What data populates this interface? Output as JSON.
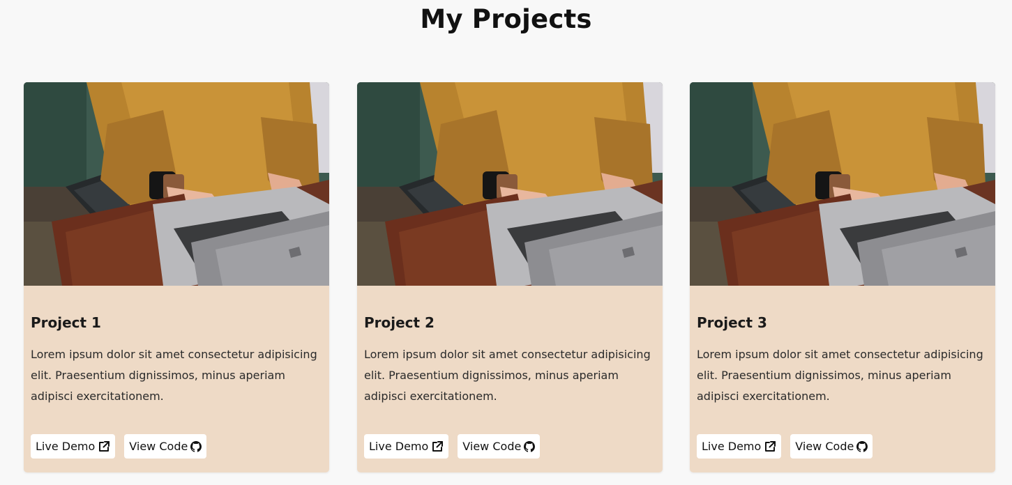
{
  "page": {
    "title": "My Projects"
  },
  "projects": [
    {
      "title": "Project 1",
      "description": "Lorem ipsum dolor sit amet consectetur adipisicing elit. Praesentium dignissimos, minus aperiam adipisci exercitationem.",
      "live_demo_label": "Live Demo",
      "view_code_label": "View Code",
      "image_icon": "laptop-photo",
      "live_demo_icon": "external-link-icon",
      "view_code_icon": "github-icon"
    },
    {
      "title": "Project 2",
      "description": "Lorem ipsum dolor sit amet consectetur adipisicing elit. Praesentium dignissimos, minus aperiam adipisci exercitationem.",
      "live_demo_label": "Live Demo",
      "view_code_label": "View Code",
      "image_icon": "laptop-photo",
      "live_demo_icon": "external-link-icon",
      "view_code_icon": "github-icon"
    },
    {
      "title": "Project 3",
      "description": "Lorem ipsum dolor sit amet consectetur adipisicing elit. Praesentium dignissimos, minus aperiam adipisci exercitationem.",
      "live_demo_label": "Live Demo",
      "view_code_label": "View Code",
      "image_icon": "laptop-photo",
      "live_demo_icon": "external-link-icon",
      "view_code_icon": "github-icon"
    }
  ],
  "colors": {
    "background": "#f8f8f8",
    "card_background": "#eedac6",
    "button_background": "#ffffff",
    "text": "#1a1a1a"
  }
}
